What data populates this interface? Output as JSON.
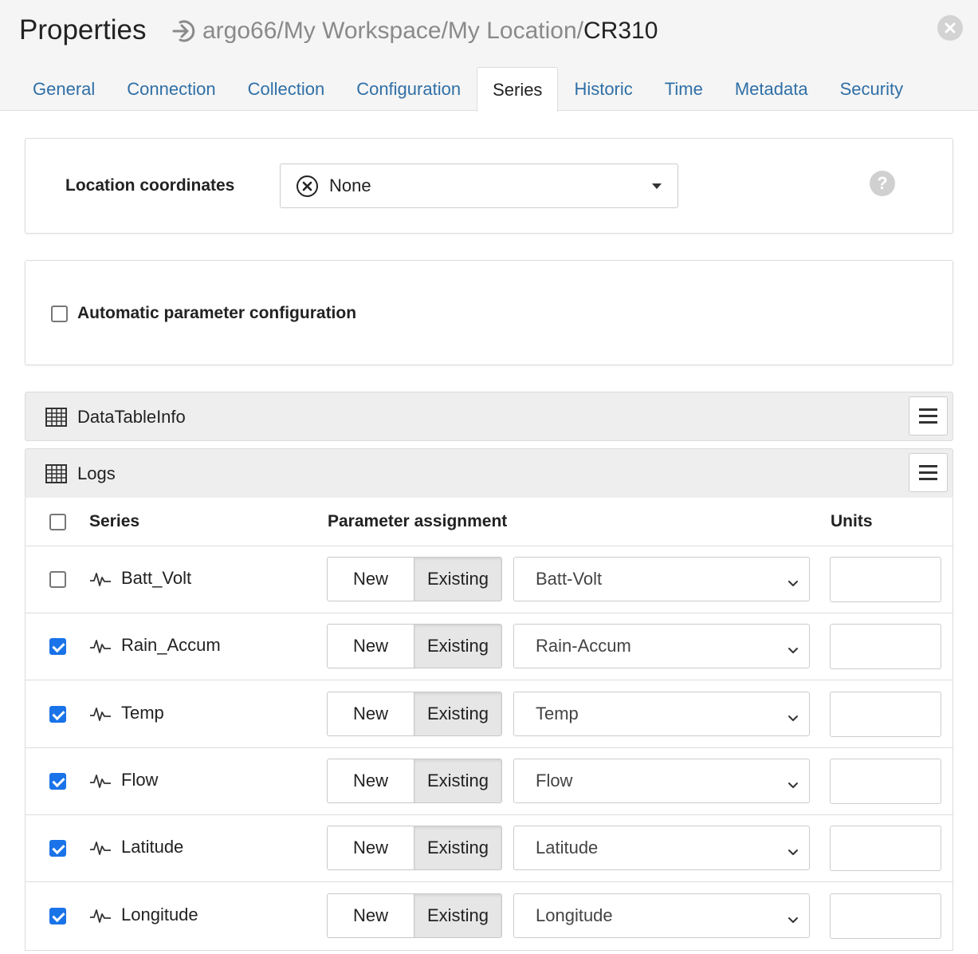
{
  "header": {
    "title": "Properties",
    "breadcrumb_path": "argo66/My Workspace/My Location/",
    "breadcrumb_current": "CR310"
  },
  "tabs": [
    {
      "label": "General"
    },
    {
      "label": "Connection"
    },
    {
      "label": "Collection"
    },
    {
      "label": "Configuration"
    },
    {
      "label": "Series",
      "active": true
    },
    {
      "label": "Historic"
    },
    {
      "label": "Time"
    },
    {
      "label": "Metadata"
    },
    {
      "label": "Security"
    }
  ],
  "location": {
    "label": "Location coordinates",
    "selected": "None"
  },
  "auto_config": {
    "label": "Automatic parameter configuration",
    "checked": false
  },
  "groups": {
    "datatable": "DataTableInfo",
    "logs": "Logs"
  },
  "table": {
    "col_series": "Series",
    "col_param": "Parameter assignment",
    "col_units": "Units",
    "new_label": "New",
    "existing_label": "Existing",
    "rows": [
      {
        "series": "Batt_Volt",
        "checked": false,
        "parameter": "Batt-Volt",
        "units": ""
      },
      {
        "series": "Rain_Accum",
        "checked": true,
        "parameter": "Rain-Accum",
        "units": ""
      },
      {
        "series": "Temp",
        "checked": true,
        "parameter": "Temp",
        "units": ""
      },
      {
        "series": "Flow",
        "checked": true,
        "parameter": "Flow",
        "units": ""
      },
      {
        "series": "Latitude",
        "checked": true,
        "parameter": "Latitude",
        "units": ""
      },
      {
        "series": "Longitude",
        "checked": true,
        "parameter": "Longitude",
        "units": ""
      }
    ]
  },
  "colors": {
    "tab_link": "#2f6fa6",
    "checkbox_checked": "#1a73e8",
    "header_bg": "#f5f5f5"
  }
}
